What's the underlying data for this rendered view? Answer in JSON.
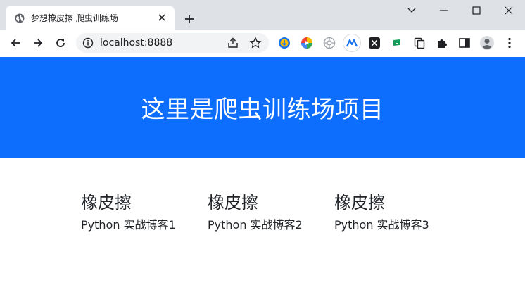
{
  "browser": {
    "tab_title": "梦想橡皮擦 爬虫训练场",
    "url": "localhost:8888"
  },
  "page": {
    "heading": "这里是爬虫训练场项目",
    "cards": [
      {
        "title": "橡皮擦",
        "text": "Python 实战博客1"
      },
      {
        "title": "橡皮擦",
        "text": "Python 实战博客2"
      },
      {
        "title": "橡皮擦",
        "text": "Python 实战博客3"
      }
    ]
  },
  "colors": {
    "brand": "#0d6efd",
    "tabstrip": "#dee1e6",
    "text": "#212529"
  }
}
